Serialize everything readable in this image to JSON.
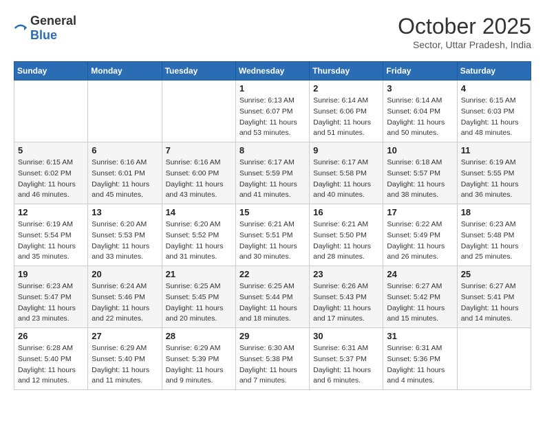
{
  "logo": {
    "general": "General",
    "blue": "Blue"
  },
  "header": {
    "month": "October 2025",
    "location": "Sector, Uttar Pradesh, India"
  },
  "weekdays": [
    "Sunday",
    "Monday",
    "Tuesday",
    "Wednesday",
    "Thursday",
    "Friday",
    "Saturday"
  ],
  "weeks": [
    [
      {
        "day": "",
        "sunrise": "",
        "sunset": "",
        "daylight": ""
      },
      {
        "day": "",
        "sunrise": "",
        "sunset": "",
        "daylight": ""
      },
      {
        "day": "",
        "sunrise": "",
        "sunset": "",
        "daylight": ""
      },
      {
        "day": "1",
        "sunrise": "Sunrise: 6:13 AM",
        "sunset": "Sunset: 6:07 PM",
        "daylight": "Daylight: 11 hours and 53 minutes."
      },
      {
        "day": "2",
        "sunrise": "Sunrise: 6:14 AM",
        "sunset": "Sunset: 6:06 PM",
        "daylight": "Daylight: 11 hours and 51 minutes."
      },
      {
        "day": "3",
        "sunrise": "Sunrise: 6:14 AM",
        "sunset": "Sunset: 6:04 PM",
        "daylight": "Daylight: 11 hours and 50 minutes."
      },
      {
        "day": "4",
        "sunrise": "Sunrise: 6:15 AM",
        "sunset": "Sunset: 6:03 PM",
        "daylight": "Daylight: 11 hours and 48 minutes."
      }
    ],
    [
      {
        "day": "5",
        "sunrise": "Sunrise: 6:15 AM",
        "sunset": "Sunset: 6:02 PM",
        "daylight": "Daylight: 11 hours and 46 minutes."
      },
      {
        "day": "6",
        "sunrise": "Sunrise: 6:16 AM",
        "sunset": "Sunset: 6:01 PM",
        "daylight": "Daylight: 11 hours and 45 minutes."
      },
      {
        "day": "7",
        "sunrise": "Sunrise: 6:16 AM",
        "sunset": "Sunset: 6:00 PM",
        "daylight": "Daylight: 11 hours and 43 minutes."
      },
      {
        "day": "8",
        "sunrise": "Sunrise: 6:17 AM",
        "sunset": "Sunset: 5:59 PM",
        "daylight": "Daylight: 11 hours and 41 minutes."
      },
      {
        "day": "9",
        "sunrise": "Sunrise: 6:17 AM",
        "sunset": "Sunset: 5:58 PM",
        "daylight": "Daylight: 11 hours and 40 minutes."
      },
      {
        "day": "10",
        "sunrise": "Sunrise: 6:18 AM",
        "sunset": "Sunset: 5:57 PM",
        "daylight": "Daylight: 11 hours and 38 minutes."
      },
      {
        "day": "11",
        "sunrise": "Sunrise: 6:19 AM",
        "sunset": "Sunset: 5:55 PM",
        "daylight": "Daylight: 11 hours and 36 minutes."
      }
    ],
    [
      {
        "day": "12",
        "sunrise": "Sunrise: 6:19 AM",
        "sunset": "Sunset: 5:54 PM",
        "daylight": "Daylight: 11 hours and 35 minutes."
      },
      {
        "day": "13",
        "sunrise": "Sunrise: 6:20 AM",
        "sunset": "Sunset: 5:53 PM",
        "daylight": "Daylight: 11 hours and 33 minutes."
      },
      {
        "day": "14",
        "sunrise": "Sunrise: 6:20 AM",
        "sunset": "Sunset: 5:52 PM",
        "daylight": "Daylight: 11 hours and 31 minutes."
      },
      {
        "day": "15",
        "sunrise": "Sunrise: 6:21 AM",
        "sunset": "Sunset: 5:51 PM",
        "daylight": "Daylight: 11 hours and 30 minutes."
      },
      {
        "day": "16",
        "sunrise": "Sunrise: 6:21 AM",
        "sunset": "Sunset: 5:50 PM",
        "daylight": "Daylight: 11 hours and 28 minutes."
      },
      {
        "day": "17",
        "sunrise": "Sunrise: 6:22 AM",
        "sunset": "Sunset: 5:49 PM",
        "daylight": "Daylight: 11 hours and 26 minutes."
      },
      {
        "day": "18",
        "sunrise": "Sunrise: 6:23 AM",
        "sunset": "Sunset: 5:48 PM",
        "daylight": "Daylight: 11 hours and 25 minutes."
      }
    ],
    [
      {
        "day": "19",
        "sunrise": "Sunrise: 6:23 AM",
        "sunset": "Sunset: 5:47 PM",
        "daylight": "Daylight: 11 hours and 23 minutes."
      },
      {
        "day": "20",
        "sunrise": "Sunrise: 6:24 AM",
        "sunset": "Sunset: 5:46 PM",
        "daylight": "Daylight: 11 hours and 22 minutes."
      },
      {
        "day": "21",
        "sunrise": "Sunrise: 6:25 AM",
        "sunset": "Sunset: 5:45 PM",
        "daylight": "Daylight: 11 hours and 20 minutes."
      },
      {
        "day": "22",
        "sunrise": "Sunrise: 6:25 AM",
        "sunset": "Sunset: 5:44 PM",
        "daylight": "Daylight: 11 hours and 18 minutes."
      },
      {
        "day": "23",
        "sunrise": "Sunrise: 6:26 AM",
        "sunset": "Sunset: 5:43 PM",
        "daylight": "Daylight: 11 hours and 17 minutes."
      },
      {
        "day": "24",
        "sunrise": "Sunrise: 6:27 AM",
        "sunset": "Sunset: 5:42 PM",
        "daylight": "Daylight: 11 hours and 15 minutes."
      },
      {
        "day": "25",
        "sunrise": "Sunrise: 6:27 AM",
        "sunset": "Sunset: 5:41 PM",
        "daylight": "Daylight: 11 hours and 14 minutes."
      }
    ],
    [
      {
        "day": "26",
        "sunrise": "Sunrise: 6:28 AM",
        "sunset": "Sunset: 5:40 PM",
        "daylight": "Daylight: 11 hours and 12 minutes."
      },
      {
        "day": "27",
        "sunrise": "Sunrise: 6:29 AM",
        "sunset": "Sunset: 5:40 PM",
        "daylight": "Daylight: 11 hours and 11 minutes."
      },
      {
        "day": "28",
        "sunrise": "Sunrise: 6:29 AM",
        "sunset": "Sunset: 5:39 PM",
        "daylight": "Daylight: 11 hours and 9 minutes."
      },
      {
        "day": "29",
        "sunrise": "Sunrise: 6:30 AM",
        "sunset": "Sunset: 5:38 PM",
        "daylight": "Daylight: 11 hours and 7 minutes."
      },
      {
        "day": "30",
        "sunrise": "Sunrise: 6:31 AM",
        "sunset": "Sunset: 5:37 PM",
        "daylight": "Daylight: 11 hours and 6 minutes."
      },
      {
        "day": "31",
        "sunrise": "Sunrise: 6:31 AM",
        "sunset": "Sunset: 5:36 PM",
        "daylight": "Daylight: 11 hours and 4 minutes."
      },
      {
        "day": "",
        "sunrise": "",
        "sunset": "",
        "daylight": ""
      }
    ]
  ]
}
